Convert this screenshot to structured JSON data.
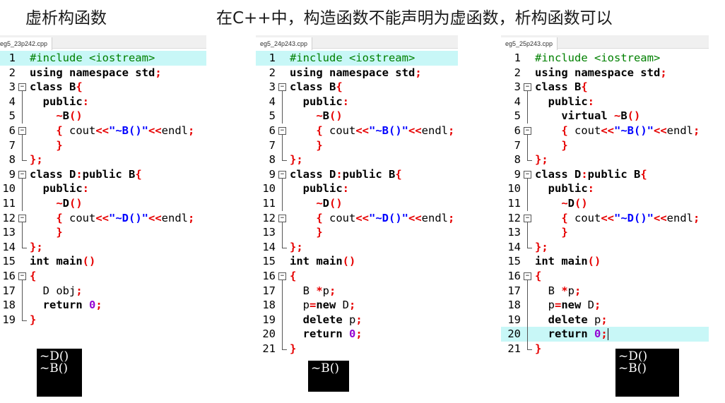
{
  "headings": {
    "left": "虚析构函数",
    "right": "在C++中，构造函数不能声明为虚函数，析构函数可以"
  },
  "panels": [
    {
      "tab": "eg5_23p242.cpp",
      "lines": [
        {
          "n": "1",
          "fold": "none",
          "hl": true,
          "t": [
            [
              "g",
              "#include <iostream>"
            ]
          ]
        },
        {
          "n": "2",
          "fold": "none",
          "t": [
            [
              "k",
              "using namespace std"
            ],
            [
              "r",
              ";"
            ]
          ]
        },
        {
          "n": "3",
          "fold": "box",
          "t": [
            [
              "k",
              "class B"
            ],
            [
              "r",
              "{"
            ]
          ]
        },
        {
          "n": "4",
          "fold": "bar",
          "t": [
            [
              "k",
              "  public"
            ],
            [
              "r",
              ":"
            ]
          ]
        },
        {
          "n": "5",
          "fold": "bar",
          "t": [
            [
              "r",
              "    ~"
            ],
            [
              "k",
              "B"
            ],
            [
              "r",
              "()"
            ]
          ]
        },
        {
          "n": "6",
          "fold": "box",
          "t": [
            [
              "r",
              "    { "
            ],
            [
              "n",
              "cout"
            ],
            [
              "r",
              "<<"
            ],
            [
              "b",
              "\"~B()\""
            ],
            [
              "r",
              "<<"
            ],
            [
              "n",
              "endl"
            ],
            [
              "r",
              ";"
            ]
          ]
        },
        {
          "n": "7",
          "fold": "bar",
          "t": [
            [
              "r",
              "    }"
            ]
          ]
        },
        {
          "n": "8",
          "fold": "end",
          "t": [
            [
              "r",
              "};"
            ]
          ]
        },
        {
          "n": "9",
          "fold": "box",
          "t": [
            [
              "k",
              "class D"
            ],
            [
              "r",
              ":"
            ],
            [
              "k",
              "public B"
            ],
            [
              "r",
              "{"
            ]
          ]
        },
        {
          "n": "10",
          "fold": "bar",
          "t": [
            [
              "k",
              "  public"
            ],
            [
              "r",
              ":"
            ]
          ]
        },
        {
          "n": "11",
          "fold": "bar",
          "t": [
            [
              "r",
              "    ~"
            ],
            [
              "k",
              "D"
            ],
            [
              "r",
              "()"
            ]
          ]
        },
        {
          "n": "12",
          "fold": "box",
          "t": [
            [
              "r",
              "    { "
            ],
            [
              "n",
              "cout"
            ],
            [
              "r",
              "<<"
            ],
            [
              "b",
              "\"~D()\""
            ],
            [
              "r",
              "<<"
            ],
            [
              "n",
              "endl"
            ],
            [
              "r",
              ";"
            ]
          ]
        },
        {
          "n": "13",
          "fold": "bar",
          "t": [
            [
              "r",
              "    }"
            ]
          ]
        },
        {
          "n": "14",
          "fold": "end",
          "t": [
            [
              "r",
              "};"
            ]
          ]
        },
        {
          "n": "15",
          "fold": "none",
          "t": [
            [
              "k",
              "int main"
            ],
            [
              "r",
              "()"
            ]
          ]
        },
        {
          "n": "16",
          "fold": "box",
          "t": [
            [
              "r",
              "{"
            ]
          ]
        },
        {
          "n": "17",
          "fold": "bar",
          "t": [
            [
              "n",
              "  D obj"
            ],
            [
              "r",
              ";"
            ]
          ]
        },
        {
          "n": "18",
          "fold": "bar",
          "t": [
            [
              "k",
              "  return "
            ],
            [
              "p",
              "0"
            ],
            [
              "r",
              ";"
            ]
          ]
        },
        {
          "n": "19",
          "fold": "end",
          "t": [
            [
              "r",
              "}"
            ]
          ]
        }
      ],
      "console": "~D()\n~B()"
    },
    {
      "tab": "eg5_24p243.cpp",
      "lines": [
        {
          "n": "1",
          "fold": "none",
          "hl": true,
          "t": [
            [
              "g",
              "#include <iostream>"
            ]
          ]
        },
        {
          "n": "2",
          "fold": "none",
          "t": [
            [
              "k",
              "using namespace std"
            ],
            [
              "r",
              ";"
            ]
          ]
        },
        {
          "n": "3",
          "fold": "box",
          "t": [
            [
              "k",
              "class B"
            ],
            [
              "r",
              "{"
            ]
          ]
        },
        {
          "n": "4",
          "fold": "bar",
          "t": [
            [
              "k",
              "  public"
            ],
            [
              "r",
              ":"
            ]
          ]
        },
        {
          "n": "5",
          "fold": "bar",
          "t": [
            [
              "r",
              "    ~"
            ],
            [
              "k",
              "B"
            ],
            [
              "r",
              "()"
            ]
          ]
        },
        {
          "n": "6",
          "fold": "box",
          "t": [
            [
              "r",
              "    { "
            ],
            [
              "n",
              "cout"
            ],
            [
              "r",
              "<<"
            ],
            [
              "b",
              "\"~B()\""
            ],
            [
              "r",
              "<<"
            ],
            [
              "n",
              "endl"
            ],
            [
              "r",
              ";"
            ]
          ]
        },
        {
          "n": "7",
          "fold": "bar",
          "t": [
            [
              "r",
              "    }"
            ]
          ]
        },
        {
          "n": "8",
          "fold": "end",
          "t": [
            [
              "r",
              "};"
            ]
          ]
        },
        {
          "n": "9",
          "fold": "box",
          "t": [
            [
              "k",
              "class D"
            ],
            [
              "r",
              ":"
            ],
            [
              "k",
              "public B"
            ],
            [
              "r",
              "{"
            ]
          ]
        },
        {
          "n": "10",
          "fold": "bar",
          "t": [
            [
              "k",
              "  public"
            ],
            [
              "r",
              ":"
            ]
          ]
        },
        {
          "n": "11",
          "fold": "bar",
          "t": [
            [
              "r",
              "    ~"
            ],
            [
              "k",
              "D"
            ],
            [
              "r",
              "()"
            ]
          ]
        },
        {
          "n": "12",
          "fold": "box",
          "t": [
            [
              "r",
              "    { "
            ],
            [
              "n",
              "cout"
            ],
            [
              "r",
              "<<"
            ],
            [
              "b",
              "\"~D()\""
            ],
            [
              "r",
              "<<"
            ],
            [
              "n",
              "endl"
            ],
            [
              "r",
              ";"
            ]
          ]
        },
        {
          "n": "13",
          "fold": "bar",
          "t": [
            [
              "r",
              "    }"
            ]
          ]
        },
        {
          "n": "14",
          "fold": "end",
          "t": [
            [
              "r",
              "};"
            ]
          ]
        },
        {
          "n": "15",
          "fold": "none",
          "t": [
            [
              "k",
              "int main"
            ],
            [
              "r",
              "()"
            ]
          ]
        },
        {
          "n": "16",
          "fold": "box",
          "t": [
            [
              "r",
              "{"
            ]
          ]
        },
        {
          "n": "17",
          "fold": "bar",
          "t": [
            [
              "n",
              "  B "
            ],
            [
              "r",
              "*"
            ],
            [
              "n",
              "p"
            ],
            [
              "r",
              ";"
            ]
          ]
        },
        {
          "n": "18",
          "fold": "bar",
          "t": [
            [
              "n",
              "  p"
            ],
            [
              "r",
              "="
            ],
            [
              "k",
              "new"
            ],
            [
              "n",
              " D"
            ],
            [
              "r",
              ";"
            ]
          ]
        },
        {
          "n": "19",
          "fold": "bar",
          "t": [
            [
              "k",
              "  delete "
            ],
            [
              "n",
              "p"
            ],
            [
              "r",
              ";"
            ]
          ]
        },
        {
          "n": "20",
          "fold": "bar",
          "t": [
            [
              "k",
              "  return "
            ],
            [
              "p",
              "0"
            ],
            [
              "r",
              ";"
            ]
          ]
        },
        {
          "n": "21",
          "fold": "end",
          "t": [
            [
              "r",
              "}"
            ]
          ]
        }
      ],
      "console": "~B()"
    },
    {
      "tab": "eg5_25p243.cpp",
      "lines": [
        {
          "n": "1",
          "fold": "none",
          "t": [
            [
              "g",
              "#include <iostream>"
            ]
          ]
        },
        {
          "n": "2",
          "fold": "none",
          "t": [
            [
              "k",
              "using namespace std"
            ],
            [
              "r",
              ";"
            ]
          ]
        },
        {
          "n": "3",
          "fold": "box",
          "t": [
            [
              "k",
              "class B"
            ],
            [
              "r",
              "{"
            ]
          ]
        },
        {
          "n": "4",
          "fold": "bar",
          "t": [
            [
              "k",
              "  public"
            ],
            [
              "r",
              ":"
            ]
          ]
        },
        {
          "n": "5",
          "fold": "bar",
          "t": [
            [
              "k",
              "    virtual "
            ],
            [
              "r",
              "~"
            ],
            [
              "k",
              "B"
            ],
            [
              "r",
              "()"
            ]
          ]
        },
        {
          "n": "6",
          "fold": "box",
          "t": [
            [
              "r",
              "    { "
            ],
            [
              "n",
              "cout"
            ],
            [
              "r",
              "<<"
            ],
            [
              "b",
              "\"~B()\""
            ],
            [
              "r",
              "<<"
            ],
            [
              "n",
              "endl"
            ],
            [
              "r",
              ";"
            ]
          ]
        },
        {
          "n": "7",
          "fold": "bar",
          "t": [
            [
              "r",
              "    }"
            ]
          ]
        },
        {
          "n": "8",
          "fold": "end",
          "t": [
            [
              "r",
              "};"
            ]
          ]
        },
        {
          "n": "9",
          "fold": "box",
          "t": [
            [
              "k",
              "class D"
            ],
            [
              "r",
              ":"
            ],
            [
              "k",
              "public B"
            ],
            [
              "r",
              "{"
            ]
          ]
        },
        {
          "n": "10",
          "fold": "bar",
          "t": [
            [
              "k",
              "  public"
            ],
            [
              "r",
              ":"
            ]
          ]
        },
        {
          "n": "11",
          "fold": "bar",
          "t": [
            [
              "r",
              "    ~"
            ],
            [
              "k",
              "D"
            ],
            [
              "r",
              "()"
            ]
          ]
        },
        {
          "n": "12",
          "fold": "box",
          "t": [
            [
              "r",
              "    { "
            ],
            [
              "n",
              "cout"
            ],
            [
              "r",
              "<<"
            ],
            [
              "b",
              "\"~D()\""
            ],
            [
              "r",
              "<<"
            ],
            [
              "n",
              "endl"
            ],
            [
              "r",
              ";"
            ]
          ]
        },
        {
          "n": "13",
          "fold": "bar",
          "t": [
            [
              "r",
              "    }"
            ]
          ]
        },
        {
          "n": "14",
          "fold": "end",
          "t": [
            [
              "r",
              "};"
            ]
          ]
        },
        {
          "n": "15",
          "fold": "none",
          "t": [
            [
              "k",
              "int main"
            ],
            [
              "r",
              "()"
            ]
          ]
        },
        {
          "n": "16",
          "fold": "box",
          "t": [
            [
              "r",
              "{"
            ]
          ]
        },
        {
          "n": "17",
          "fold": "bar",
          "t": [
            [
              "n",
              "  B "
            ],
            [
              "r",
              "*"
            ],
            [
              "n",
              "p"
            ],
            [
              "r",
              ";"
            ]
          ]
        },
        {
          "n": "18",
          "fold": "bar",
          "t": [
            [
              "n",
              "  p"
            ],
            [
              "r",
              "="
            ],
            [
              "k",
              "new"
            ],
            [
              "n",
              " D"
            ],
            [
              "r",
              ";"
            ]
          ]
        },
        {
          "n": "19",
          "fold": "bar",
          "t": [
            [
              "k",
              "  delete "
            ],
            [
              "n",
              "p"
            ],
            [
              "r",
              ";"
            ]
          ]
        },
        {
          "n": "20",
          "fold": "bar",
          "hl": true,
          "caret": true,
          "t": [
            [
              "k",
              "  return "
            ],
            [
              "p",
              "0"
            ],
            [
              "r",
              ";"
            ]
          ]
        },
        {
          "n": "21",
          "fold": "end",
          "t": [
            [
              "r",
              "}"
            ]
          ]
        }
      ],
      "console": "~D()\n~B()"
    }
  ]
}
